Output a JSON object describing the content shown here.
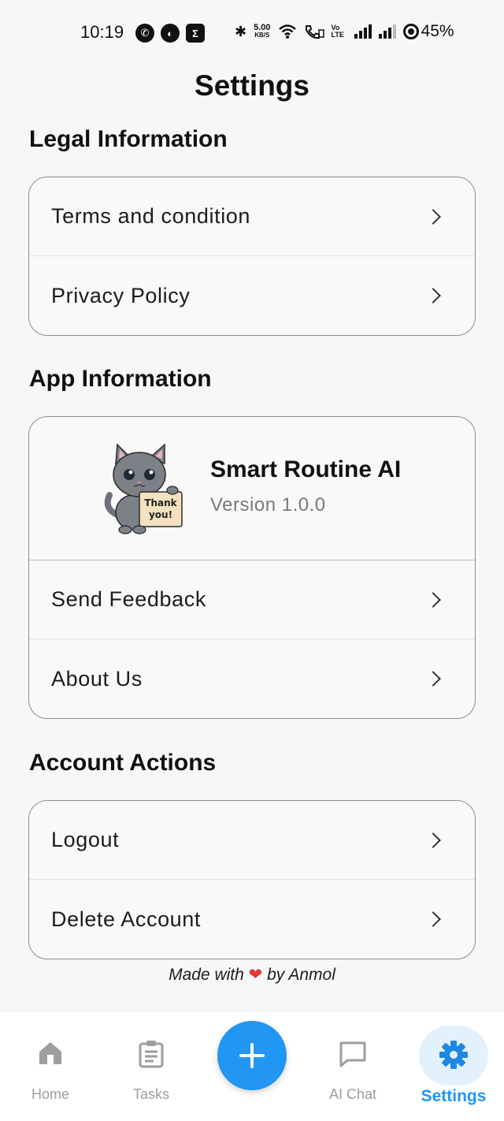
{
  "status_bar": {
    "time": "10:19",
    "net_speed_value": "5.00",
    "net_speed_unit": "KB/S",
    "volte": "Vo LTE",
    "battery": "45%"
  },
  "page": {
    "title": "Settings"
  },
  "legal": {
    "title": "Legal Information",
    "items": [
      {
        "label": "Terms and condition"
      },
      {
        "label": "Privacy Policy"
      }
    ]
  },
  "app_info": {
    "title": "App Information",
    "app_name": "Smart Routine AI",
    "version": "Version 1.0.0",
    "logo_sign": "Thank you!",
    "items": [
      {
        "label": "Send Feedback"
      },
      {
        "label": "About Us"
      }
    ]
  },
  "account": {
    "title": "Account Actions",
    "items": [
      {
        "label": "Logout"
      },
      {
        "label": "Delete Account"
      }
    ]
  },
  "footer": {
    "made_with": "Made with",
    "heart": "❤",
    "by": "by Anmol"
  },
  "nav": {
    "items": [
      {
        "label": "Home",
        "icon": "home-icon"
      },
      {
        "label": "Tasks",
        "icon": "clipboard-icon"
      },
      {
        "label": "",
        "icon": "plus-icon"
      },
      {
        "label": "AI Chat",
        "icon": "chat-bubble-icon"
      },
      {
        "label": "Settings",
        "icon": "gear-icon"
      }
    ],
    "active": "Settings"
  },
  "colors": {
    "accent": "#2196f3",
    "active_bubble": "#e3f1fd",
    "heart": "#e53935"
  }
}
